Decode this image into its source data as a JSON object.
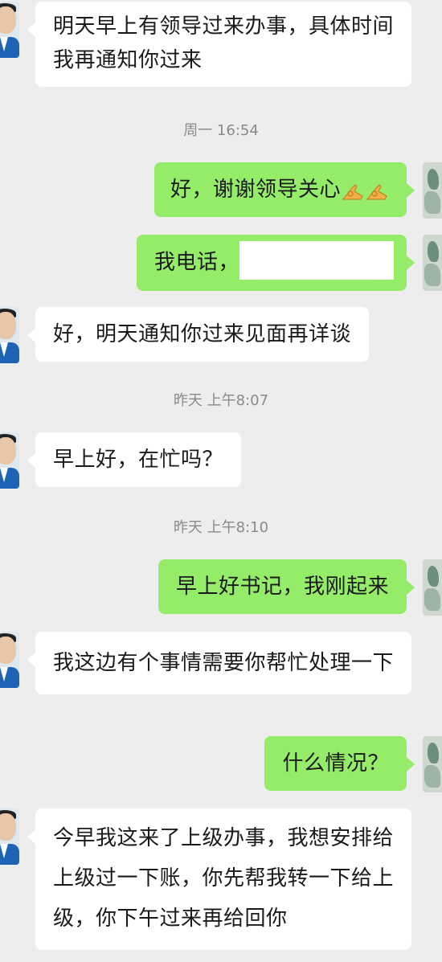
{
  "messages": {
    "m1": "明天早上有领导过来办事，具体时间我再通知你过来",
    "m2": "好，谢谢领导关心",
    "m2_emoji": "👌👌",
    "m3": "我电话，",
    "m4": "好，明天通知你过来见面再详谈",
    "m5": "早上好，在忙吗？",
    "m6": "早上好书记，我刚起来",
    "m7": "我这边有个事情需要你帮忙处理一下",
    "m8": "什么情况？",
    "m9": "今早我这来了上级办事，我想安排给上级过一下账，你先帮我转一下给上级，你下午过来再给回你"
  },
  "timestamps": {
    "t1": "周一 16:54",
    "t2": "昨天 上午8:07",
    "t3": "昨天 上午8:10"
  },
  "colors": {
    "background": "#ededed",
    "incoming_bubble": "#ffffff",
    "outgoing_bubble": "#95ec69",
    "timestamp_text": "#8a8a8a"
  }
}
